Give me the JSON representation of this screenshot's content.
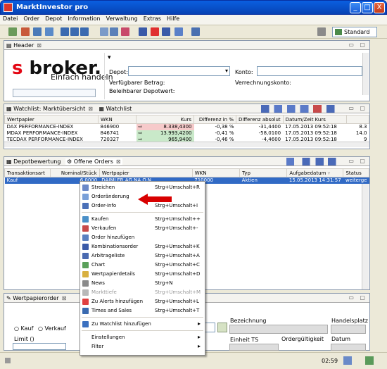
{
  "window": {
    "title": "MarktInvestor pro",
    "min": "_",
    "max": "□",
    "close": "X"
  },
  "menu": [
    "Datei",
    "Order",
    "Depot",
    "Information",
    "Verwaltung",
    "Extras",
    "Hilfe"
  ],
  "toolbar": {
    "perspective": "Standard"
  },
  "header_panel": {
    "tab": "Header",
    "logo_prefix": "s",
    "logo_word": "broker.",
    "slogan": "Einfach handeln",
    "depot_label": "Depot:",
    "konto_label": "Konto:",
    "verfuegbar_label": "Verfügbarer Betrag:",
    "verrechnung_label": "Verrechnungskonto:",
    "beleihbar_label": "Beleihbarer Depotwert:"
  },
  "watchlist_panel": {
    "tabs": [
      "Watchlist: Marktübersicht",
      "Watchlist"
    ],
    "columns": [
      "Wertpapier",
      "WKN",
      "Kurs",
      "Differenz in %",
      "Differenz absolut",
      "Datum/Zeit Kurs"
    ],
    "rows": [
      {
        "name": "DAX PERFORMANCE-INDEX",
        "wkn": "846900",
        "kurs": "8.338,4300",
        "pct": "-0,38 %",
        "abs": "-31,4400",
        "dt": "17.05.2013 09:52:18",
        "extra": "8.3",
        "color": "#f6caca"
      },
      {
        "name": "MDAX PERFORMANCE-INDEX",
        "wkn": "846741",
        "kurs": "13.993,4200",
        "pct": "-0,41 %",
        "abs": "-58,0100",
        "dt": "17.05.2013 09:52:18",
        "extra": "14.0",
        "color": "#c9e9c9"
      },
      {
        "name": "TECDAX PERFORMANCE-INDEX",
        "wkn": "720327",
        "kurs": "965,9400",
        "pct": "-0,46 %",
        "abs": "-4,4600",
        "dt": "17.05.2013 09:52:18",
        "extra": "9",
        "color": "#c9e9c9"
      }
    ]
  },
  "orders_panel": {
    "tabs": [
      "Depotbewertung",
      "Offene Orders"
    ],
    "columns": [
      "Transaktionsart",
      "Nominal/Stück",
      "Wertpapier",
      "WKN",
      "Typ",
      "Aufgabedatum",
      "Status"
    ],
    "rows": [
      {
        "art": "Kauf",
        "nominal": "6,0000",
        "wp": "DAIMLER AG NA O.N.",
        "wkn": "710000",
        "typ": "Aktien",
        "datum": "15.05.2013 14:31:57",
        "status": "weiterge"
      }
    ]
  },
  "context_menu": [
    {
      "label": "Streichen",
      "shortcut": "Strg+Umschalt+R",
      "icon": "#6a88c8"
    },
    {
      "label": "Orderänderung",
      "shortcut": "",
      "icon": "#7aa0d8"
    },
    {
      "label": "Order-Info",
      "shortcut": "Strg+Umschalt+I",
      "icon": "#4a70b8"
    },
    {
      "sep": true
    },
    {
      "label": "Kaufen",
      "shortcut": "Strg+Umschalt++",
      "icon": "#4a90c8"
    },
    {
      "label": "Verkaufen",
      "shortcut": "Strg+Umschalt+-",
      "icon": "#c84a4a"
    },
    {
      "label": "Order hinzufügen",
      "shortcut": "",
      "icon": "#5a80c0"
    },
    {
      "label": "Kombinationsorder",
      "shortcut": "Strg+Umschalt+K",
      "icon": "#3a5aa8"
    },
    {
      "label": "Arbitrageliste",
      "shortcut": "Strg+Umschalt+A",
      "icon": "#4a6ab0"
    },
    {
      "label": "Chart",
      "shortcut": "Strg+Umschalt+C",
      "icon": "#5aa05a"
    },
    {
      "label": "Wertpapierdetails",
      "shortcut": "Strg+Umschalt+D",
      "icon": "#d8b040"
    },
    {
      "label": "News",
      "shortcut": "Strg+N",
      "icon": "#8a8a8a"
    },
    {
      "label": "Markttiefe",
      "shortcut": "Strg+Umschalt+M",
      "icon": "#b8b8b8",
      "disabled": true
    },
    {
      "label": "Zu Alerts hinzufügen",
      "shortcut": "Strg+Umschalt+L",
      "icon": "#e04040"
    },
    {
      "label": "Times and Sales",
      "shortcut": "Strg+Umschalt+T",
      "icon": "#3a6ab0"
    },
    {
      "sep": true
    },
    {
      "label": "Zu Watchlist hinzufügen",
      "shortcut": "",
      "icon": "#3a70c0",
      "submenu": "▸"
    },
    {
      "sep": true
    },
    {
      "label": "Einstellungen",
      "shortcut": "",
      "icon": "",
      "submenu": "▸"
    },
    {
      "label": "Filter",
      "shortcut": "",
      "icon": "",
      "submenu": "▸"
    }
  ],
  "wertpapierorder_panel": {
    "tab": "Wertpapierorder",
    "kauf": "Kauf",
    "verkauf": "Verkauf",
    "limit": "Limit ()",
    "bezeichnung": "Bezeichnung",
    "handelsplatz": "Handelsplatz",
    "einheit": "Einheit TS",
    "ordergueltigkeit": "Ordergültigkeit",
    "datum": "Datum"
  },
  "statusbar": {
    "time": "02:59"
  }
}
